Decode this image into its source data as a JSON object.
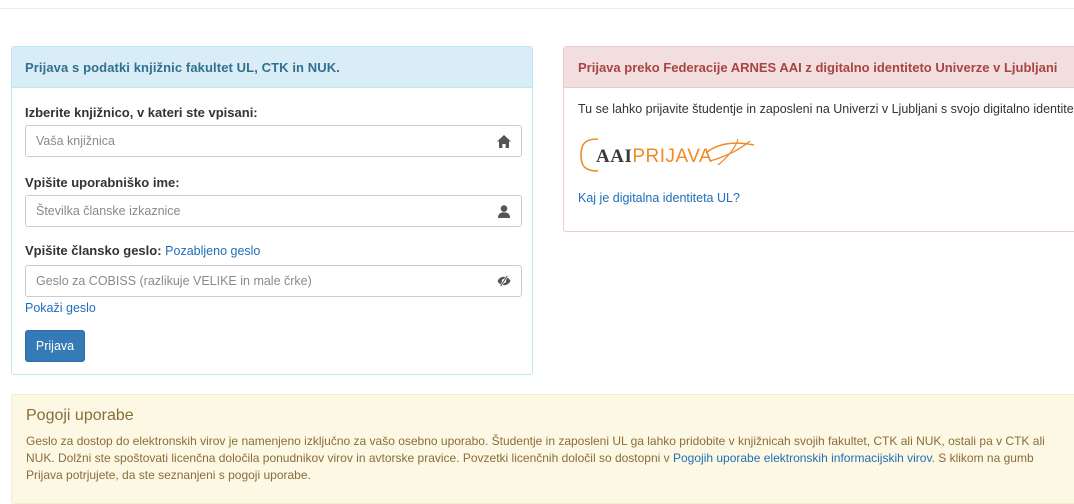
{
  "library_login": {
    "title": "Prijava s podatki knjižnic fakultet UL, CTK in NUK.",
    "library_label": "Izberite knjižnico, v kateri ste vpisani:",
    "library_placeholder": "Vaša knjižnica",
    "username_label": "Vpišite uporabniško ime:",
    "username_placeholder": "Številka članske izkaznice",
    "password_label": "Vpišite člansko geslo:",
    "forgot_password_link": "Pozabljeno geslo",
    "password_placeholder": "Geslo za COBISS (razlikuje VELIKE in male črke)",
    "show_password_link": "Pokaži geslo",
    "submit_label": "Prijava"
  },
  "arnes_login": {
    "title": "Prijava preko Federacije ARNES AAI z digitalno identiteto Univerze v Ljubljani",
    "description": "Tu se lahko prijavite študentje in zaposleni na Univerzi v Ljubljani s svojo digitalno identiteto UL.",
    "logo_bold": "AAI",
    "logo_light": "PRIJAVA",
    "digital_identity_link": "Kaj je digitalna identiteta UL?"
  },
  "terms": {
    "title": "Pogoji uporabe",
    "text_before_link": "Geslo za dostop do elektronskih virov je namenjeno izključno za vašo osebno uporabo. Študentje in zaposleni UL ga lahko pridobite v knjižnicah svojih fakultet, CTK ali NUK, ostali pa v CTK ali NUK. Dolžni ste spoštovati licenčna določila ponudnikov virov in avtorske pravice. Povzetki licenčnih določil so dostopni v ",
    "link_text": "Pogojih uporabe elektronskih informacijskih virov",
    "text_after_link": ". S klikom na gumb Prijava potrjujete, da ste seznanjeni s pogoji uporabe."
  },
  "icons": {
    "library": "home-icon",
    "username": "user-icon",
    "password": "eye-slash-icon"
  },
  "colors": {
    "primary": "#337ab7",
    "info_header": "#d9edf7",
    "danger_header": "#f2dede",
    "warning_bg": "#fcf8e3",
    "logo_accent": "#f08a24"
  }
}
